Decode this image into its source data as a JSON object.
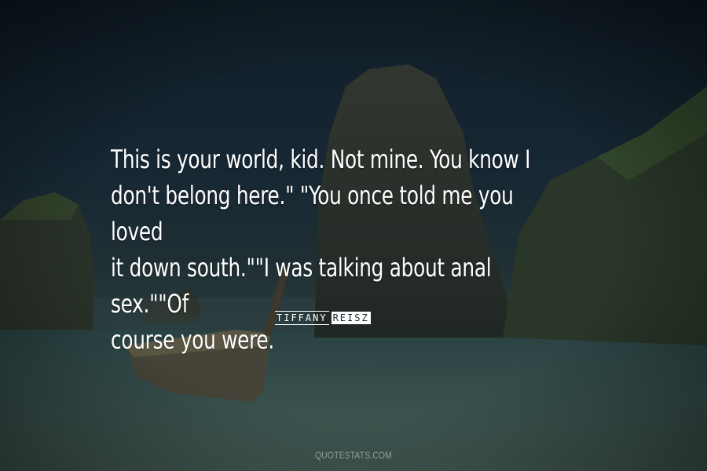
{
  "quote": {
    "lines": [
      "This is your world, kid. Not mine. You know I",
      "don't belong here.\" \"You once told me you loved",
      "it down south.\"\"I was talking about anal sex.\"\"Of",
      "course you were."
    ]
  },
  "author": {
    "first": "TIFFANY",
    "last": "REISZ"
  },
  "watermark": "QUOTESTATS.COM",
  "colors": {
    "text": "#ffffff",
    "sky": "#13212c",
    "water": "#5d7a6e"
  }
}
